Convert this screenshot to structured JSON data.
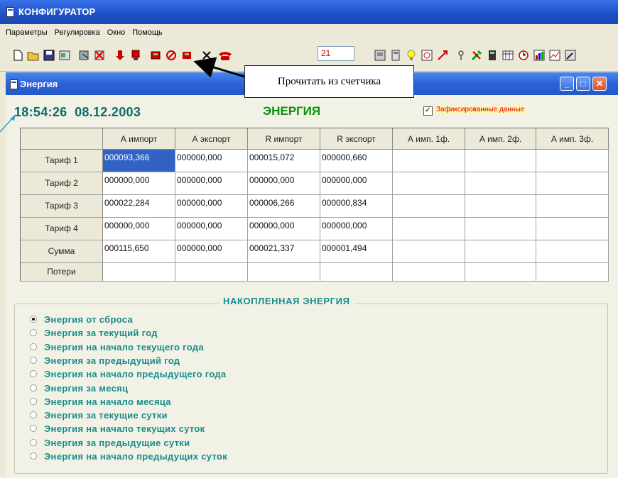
{
  "app": {
    "title": "КОНФИГУРАТОР"
  },
  "menu": [
    {
      "label": "Параметры"
    },
    {
      "label": "Регулировка"
    },
    {
      "label": "Окно"
    },
    {
      "label": "Помощь"
    }
  ],
  "toolbar": {
    "field_value": "21"
  },
  "callout": {
    "text": "Прочитать из счетчика"
  },
  "window": {
    "title": "Энергия"
  },
  "header": {
    "time": "18:54:26",
    "date": "08.12.2003",
    "energy_label": "ЭНЕРГИЯ",
    "fixed_checked": true,
    "fixed_label": "Зафиксированные  данные"
  },
  "table": {
    "columns": [
      "А импорт",
      "А экспорт",
      "R импорт",
      "R экспорт",
      "А имп. 1ф.",
      "А имп. 2ф.",
      "А имп. 3ф."
    ],
    "rows": [
      {
        "label": "Тариф 1",
        "cells": [
          "000093,366",
          "000000,000",
          "000015,072",
          "000000,660",
          "",
          "",
          ""
        ]
      },
      {
        "label": "Тариф 2",
        "cells": [
          "000000,000",
          "000000,000",
          "000000,000",
          "000000,000",
          "",
          "",
          ""
        ]
      },
      {
        "label": "Тариф 3",
        "cells": [
          "000022,284",
          "000000,000",
          "000006,266",
          "000000,834",
          "",
          "",
          ""
        ]
      },
      {
        "label": "Тариф 4",
        "cells": [
          "000000,000",
          "000000,000",
          "000000,000",
          "000000,000",
          "",
          "",
          ""
        ]
      },
      {
        "label": "Сумма",
        "cells": [
          "000115,650",
          "000000,000",
          "000021,337",
          "000001,494",
          "",
          "",
          ""
        ]
      },
      {
        "label": "Потери",
        "cells": [
          "",
          "",
          "",
          "",
          "",
          "",
          ""
        ]
      }
    ]
  },
  "accumulated": {
    "title": "НАКОПЛЕННАЯ  ЭНЕРГИЯ",
    "options": [
      {
        "label": "Энергия от сброса",
        "checked": true
      },
      {
        "label": "Энергия за текущий год",
        "checked": false
      },
      {
        "label": "Энергия на начало текущего года",
        "checked": false
      },
      {
        "label": "Энергия за предыдущий год",
        "checked": false
      },
      {
        "label": "Энергия на начало предыдущего года",
        "checked": false
      },
      {
        "label": "Энергия за месяц",
        "checked": false
      },
      {
        "label": "Энергия на начало месяца",
        "checked": false
      },
      {
        "label": "Энергия за текущие сутки",
        "checked": false
      },
      {
        "label": "Энергия на начало текущих суток",
        "checked": false
      },
      {
        "label": "Энергия за предыдущие сутки",
        "checked": false
      },
      {
        "label": "Энергия на начало предыдущих суток",
        "checked": false
      }
    ]
  },
  "icons": [
    "new-file-icon",
    "open-folder-icon",
    "save-icon",
    "properties-icon",
    "connect-meter-icon",
    "disconnect-meter-icon",
    "download-icon",
    "upload-icon",
    "read-meter-icon",
    "stop-icon",
    "meter-flag-icon",
    "close-x-icon",
    "phone-icon",
    "meter-icon",
    "device-icon",
    "bulb-icon",
    "clock-schedule-icon",
    "arrow-icon",
    "key-icon",
    "tools-icon",
    "calculator-icon",
    "calendar-icon",
    "clock-icon",
    "chart-icon",
    "graph-icon",
    "magic-icon"
  ]
}
